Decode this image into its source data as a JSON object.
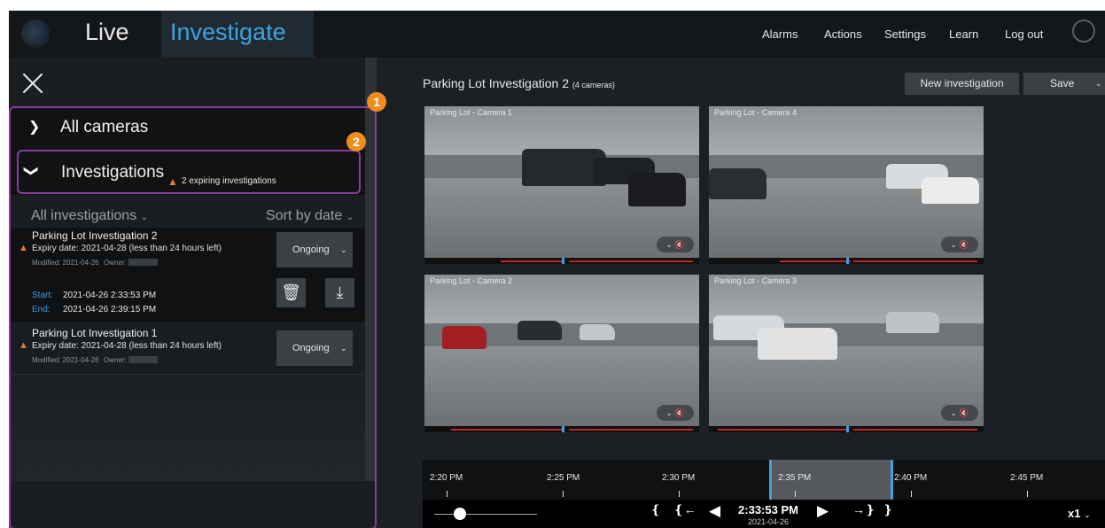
{
  "nav": {
    "tab_live": "Live",
    "tab_investigate": "Investigate",
    "links": [
      "Alarms",
      "Actions",
      "Settings",
      "Learn",
      "Log out"
    ]
  },
  "sidebar": {
    "all_cameras": "All cameras",
    "investigations": "Investigations",
    "expiring_warning": "2 expiring investigations",
    "filter": "All investigations",
    "sort": "Sort by date",
    "items": [
      {
        "title": "Parking Lot Investigation 2",
        "expiry": "Expiry date: 2021-04-28 (less than 24 hours left)",
        "modified": "Modified: 2021-04-26",
        "owner_label": "Owner:",
        "status": "Ongoing",
        "start_label": "Start:",
        "start": "2021-04-26 2:33:53 PM",
        "end_label": "End:",
        "end": "2021-04-26 2:39:15 PM"
      },
      {
        "title": "Parking Lot Investigation 1",
        "expiry": "Expiry date: 2021-04-28 (less than 24 hours left)",
        "modified": "Modified: 2021-04-26",
        "owner_label": "Owner:",
        "status": "Ongoing"
      }
    ]
  },
  "annotations": {
    "badge1": "1",
    "badge2": "2"
  },
  "main": {
    "title": "Parking Lot Investigation 2",
    "camera_count": "(4 cameras)",
    "new_investigation": "New investigation",
    "save": "Save",
    "cameras": [
      "Parking Lot - Camera 1",
      "Parking Lot - Camera 4",
      "Parking Lot - Camera 2",
      "Parking Lot - Camera 3"
    ]
  },
  "timeline": {
    "ticks": [
      "2:20 PM",
      "2:25 PM",
      "2:30 PM",
      "2:35 PM",
      "2:40 PM",
      "2:45 PM"
    ],
    "current_time": "2:33:53 PM",
    "current_date": "2021-04-26",
    "speed": "x1"
  },
  "icons": {
    "dropdown": "chevron-down-icon",
    "warning": "warning-triangle-icon",
    "delete": "trash-icon",
    "export": "download-icon"
  },
  "colors": {
    "accent": "#3fa1e0",
    "warning": "#e8773b",
    "annotation": "#8a3aa0",
    "badge": "#f08c1e"
  }
}
